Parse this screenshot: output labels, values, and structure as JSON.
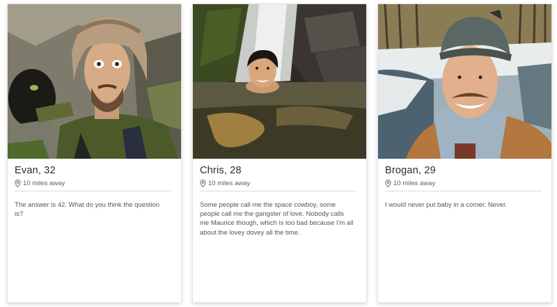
{
  "profiles": [
    {
      "name": "Evan, 32",
      "distance": "10 miles away",
      "bio": "The answer is 42. What do you think the question is?",
      "photo_subject": "man-in-fur-hat-selfie"
    },
    {
      "name": "Chris, 28",
      "distance": "10 miles away",
      "bio": "Some people call me the space cowboy, some people call me the gangster of love. Nobody calls me Maurice though, which is too bad because I'm all about the lovey dovey all the time.",
      "photo_subject": "man-swimming-by-waterfall"
    },
    {
      "name": "Brogan, 29",
      "distance": "10 miles away",
      "bio": "I would never put baby in a corner. Never.",
      "photo_subject": "man-in-wool-cap-by-river"
    }
  ],
  "icons": {
    "distance": "location-pin-icon"
  }
}
